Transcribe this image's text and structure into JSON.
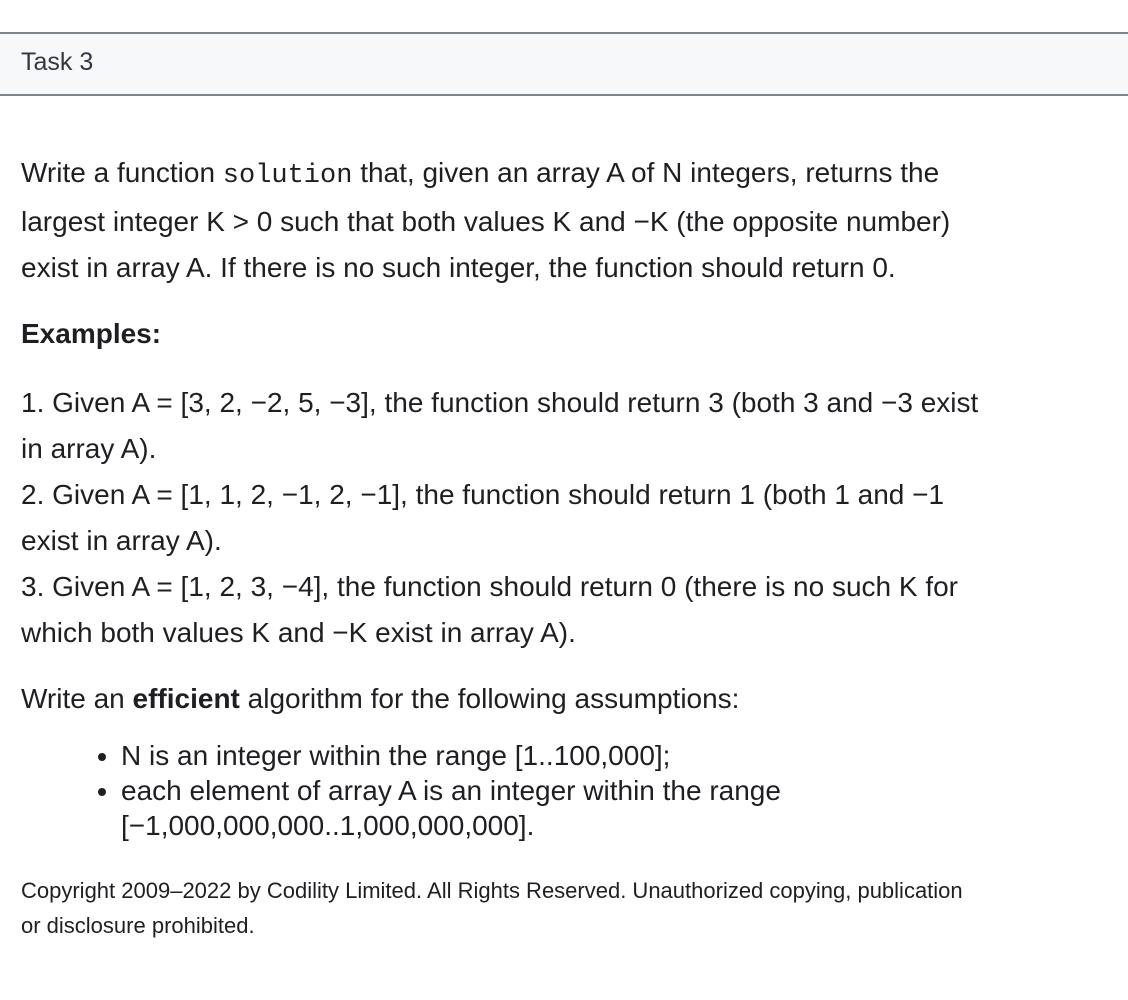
{
  "header": {
    "title": "Task 3"
  },
  "description": {
    "line1_pre": "Write a function ",
    "line1_code": "solution",
    "line1_post": " that, given an array A of N integers, returns the",
    "line2": "largest integer K > 0 such that both values K and −K (the opposite number)",
    "line3": "exist in array A. If there is no such integer, the function should return 0."
  },
  "examples": {
    "heading": "Examples:",
    "items": [
      {
        "line1": "1. Given A = [3, 2, −2, 5, −3], the function should return 3 (both 3 and −3 exist",
        "line2": "in array A)."
      },
      {
        "line1": "2. Given A = [1, 1, 2, −1, 2, −1], the function should return 1 (both 1 and −1",
        "line2": "exist in array A)."
      },
      {
        "line1": "3. Given A = [1, 2, 3, −4], the function should return 0 (there is no such K for",
        "line2": "which both values K and −K exist in array A)."
      }
    ]
  },
  "assumptions": {
    "intro_pre": "Write an ",
    "intro_bold": "efficient",
    "intro_post": " algorithm for the following assumptions:",
    "items": [
      {
        "line1": "N is an integer within the range [1..100,000];"
      },
      {
        "line1": "each element of array A is an integer within the range",
        "line2": "[−1,000,000,000..1,000,000,000]."
      }
    ]
  },
  "footer": {
    "line1": "Copyright 2009–2022 by Codility Limited. All Rights Reserved. Unauthorized copying, publication",
    "line2": "or disclosure prohibited."
  }
}
